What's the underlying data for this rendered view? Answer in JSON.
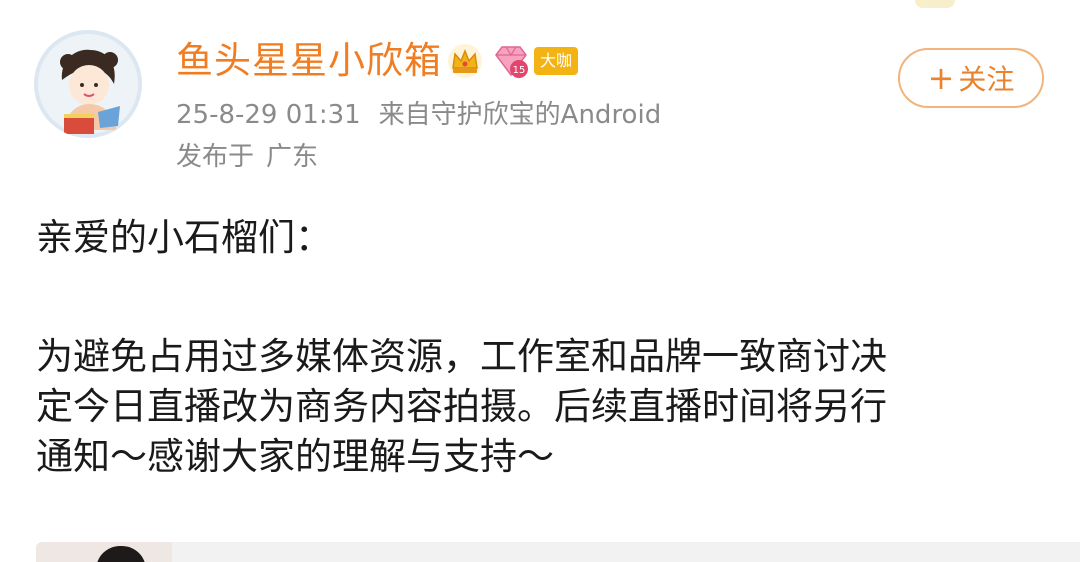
{
  "post": {
    "author": {
      "name": "鱼头星星小欣箱",
      "avatar_icon": "avatar-illustration",
      "badges": {
        "crown_icon": "crown-icon",
        "level_icon": "diamond-level-icon",
        "level_number": "15",
        "vip_label": "大咖"
      }
    },
    "meta": {
      "timestamp": "25-8-29 01:31",
      "source": "来自守护欣宝的Android",
      "location_prefix": "发布于",
      "location": "广东"
    },
    "follow_button": {
      "plus": "+",
      "label": "关注"
    },
    "content": {
      "greeting": "亲爱的小石榴们：",
      "lines": [
        "为避免占用过多媒体资源，工作室和品牌一致商讨决",
        "定今日直播改为商务内容拍摄。后续直播时间将另行",
        "通知～感谢大家的理解与支持～"
      ]
    }
  },
  "colors": {
    "username": "#f07d22",
    "meta_text": "#8a8a8a",
    "follow_border": "#f2b37d",
    "follow_text": "#e9832e",
    "vip_badge": "#f3b315",
    "body_text": "#1a1a1a"
  }
}
